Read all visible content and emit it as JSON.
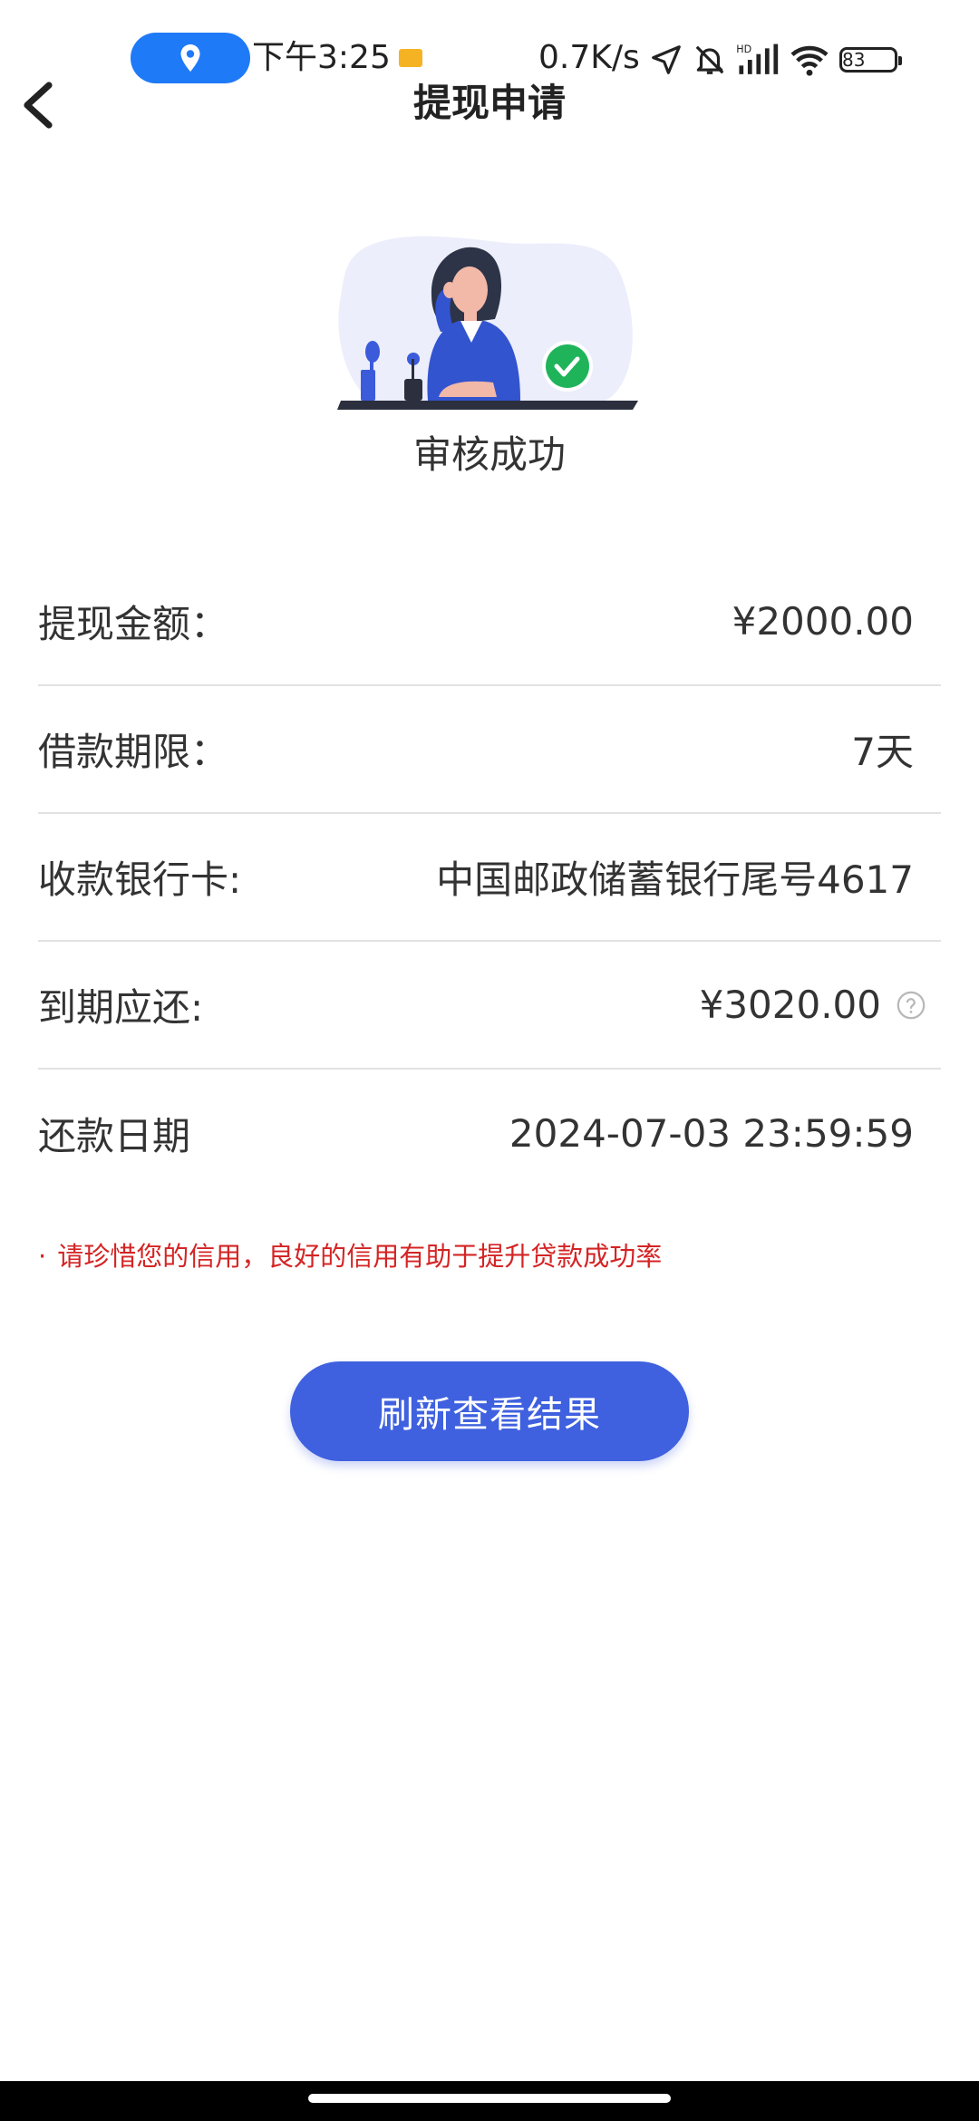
{
  "status_bar": {
    "time": "下午3:25",
    "net_speed": "0.7K/s",
    "battery": "83",
    "icons": [
      "location-pill-icon",
      "notification-flag-icon",
      "navigation-arrow-icon",
      "bell-muted-icon",
      "hd-signal-icon",
      "wifi-icon",
      "battery-icon"
    ]
  },
  "header": {
    "title": "提现申请",
    "back_icon": "chevron-left-icon"
  },
  "status": {
    "title": "审核成功",
    "illustration": "woman-at-desk-with-check-illustration"
  },
  "details": [
    {
      "label": "提现金额：",
      "value": "¥2000.00"
    },
    {
      "label": "借款期限：",
      "value": "7天"
    },
    {
      "label": "收款银行卡:",
      "value": "中国邮政储蓄银行尾号4617"
    },
    {
      "label": "到期应还:",
      "value": "¥3020.00",
      "help_icon": "question-circle-icon"
    },
    {
      "label": "还款日期",
      "value": "2024-07-03 23:59:59"
    }
  ],
  "tip": {
    "bullet": "·",
    "text": "请珍惜您的信用，良好的信用有助于提升贷款成功率"
  },
  "actions": {
    "refresh_label": "刷新查看结果"
  },
  "colors": {
    "accent": "#3f61df",
    "tip_text": "#d42424",
    "success": "#1fb45a",
    "location_pill": "#1f7af7"
  }
}
